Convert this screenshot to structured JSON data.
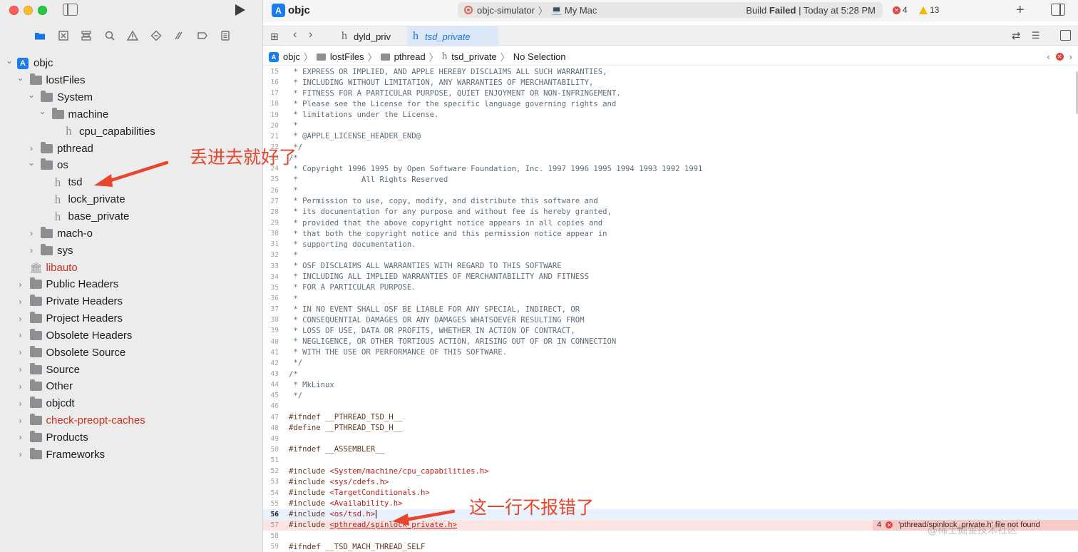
{
  "window": {
    "project_title": "objc",
    "scheme_target": "objc-simulator",
    "scheme_device": "My Mac",
    "build_status_prefix": "Build ",
    "build_status_result": "Failed",
    "build_status_time": " | Today at 5:28 PM",
    "error_count": "4",
    "warning_count": "13"
  },
  "sidebar": {
    "tree": [
      {
        "label": "objc",
        "depth": 0,
        "type": "app",
        "expanded": true
      },
      {
        "label": "lostFiles",
        "depth": 1,
        "type": "folder",
        "expanded": true
      },
      {
        "label": "System",
        "depth": 2,
        "type": "folder",
        "expanded": true
      },
      {
        "label": "machine",
        "depth": 3,
        "type": "folder",
        "expanded": true
      },
      {
        "label": "cpu_capabilities",
        "depth": 4,
        "type": "header"
      },
      {
        "label": "pthread",
        "depth": 2,
        "type": "folder",
        "expanded": false
      },
      {
        "label": "os",
        "depth": 2,
        "type": "folder",
        "expanded": true
      },
      {
        "label": "tsd",
        "depth": 3,
        "type": "header"
      },
      {
        "label": "lock_private",
        "depth": 3,
        "type": "header"
      },
      {
        "label": "base_private",
        "depth": 3,
        "type": "header"
      },
      {
        "label": "mach-o",
        "depth": 2,
        "type": "folder",
        "expanded": false
      },
      {
        "label": "sys",
        "depth": 2,
        "type": "folder",
        "expanded": false
      },
      {
        "label": "libauto",
        "depth": 1,
        "type": "library",
        "red": true
      },
      {
        "label": "Public Headers",
        "depth": 1,
        "type": "folder",
        "expanded": false
      },
      {
        "label": "Private Headers",
        "depth": 1,
        "type": "folder",
        "expanded": false
      },
      {
        "label": "Project Headers",
        "depth": 1,
        "type": "folder",
        "expanded": false
      },
      {
        "label": "Obsolete Headers",
        "depth": 1,
        "type": "folder",
        "expanded": false
      },
      {
        "label": "Obsolete Source",
        "depth": 1,
        "type": "folder",
        "expanded": false
      },
      {
        "label": "Source",
        "depth": 1,
        "type": "folder",
        "expanded": false
      },
      {
        "label": "Other",
        "depth": 1,
        "type": "folder",
        "expanded": false
      },
      {
        "label": "objcdt",
        "depth": 1,
        "type": "folder",
        "expanded": false
      },
      {
        "label": "check-preopt-caches",
        "depth": 1,
        "type": "folder",
        "expanded": false,
        "red": true
      },
      {
        "label": "Products",
        "depth": 1,
        "type": "folder",
        "expanded": false
      },
      {
        "label": "Frameworks",
        "depth": 1,
        "type": "folder",
        "expanded": false
      }
    ]
  },
  "tabs": [
    {
      "label": "dyld_priv",
      "active": false
    },
    {
      "label": "tsd_private",
      "active": true
    }
  ],
  "jumpbar": {
    "items": [
      "objc",
      "lostFiles",
      "pthread",
      "tsd_private"
    ],
    "selection": "No Selection"
  },
  "code": {
    "current_line": 56,
    "error_line": 57,
    "lines": [
      {
        "n": "15",
        "text": " * EXPRESS OR IMPLIED, AND APPLE HEREBY DISCLAIMS ALL SUCH WARRANTIES,"
      },
      {
        "n": "16",
        "text": " * INCLUDING WITHOUT LIMITATION, ANY WARRANTIES OF MERCHANTABILITY,"
      },
      {
        "n": "17",
        "text": " * FITNESS FOR A PARTICULAR PURPOSE, QUIET ENJOYMENT OR NON-INFRINGEMENT."
      },
      {
        "n": "18",
        "text": " * Please see the License for the specific language governing rights and"
      },
      {
        "n": "19",
        "text": " * limitations under the License."
      },
      {
        "n": "20",
        "text": " *"
      },
      {
        "n": "21",
        "text": " * @APPLE_LICENSE_HEADER_END@"
      },
      {
        "n": "22",
        "text": " */"
      },
      {
        "n": "23",
        "text": "/*"
      },
      {
        "n": "24",
        "text": " * Copyright 1996 1995 by Open Software Foundation, Inc. 1997 1996 1995 1994 1993 1992 1991"
      },
      {
        "n": "25",
        "text": " *              All Rights Reserved"
      },
      {
        "n": "26",
        "text": " *"
      },
      {
        "n": "27",
        "text": " * Permission to use, copy, modify, and distribute this software and"
      },
      {
        "n": "28",
        "text": " * its documentation for any purpose and without fee is hereby granted,"
      },
      {
        "n": "29",
        "text": " * provided that the above copyright notice appears in all copies and"
      },
      {
        "n": "30",
        "text": " * that both the copyright notice and this permission notice appear in"
      },
      {
        "n": "31",
        "text": " * supporting documentation."
      },
      {
        "n": "32",
        "text": " *"
      },
      {
        "n": "33",
        "text": " * OSF DISCLAIMS ALL WARRANTIES WITH REGARD TO THIS SOFTWARE"
      },
      {
        "n": "34",
        "text": " * INCLUDING ALL IMPLIED WARRANTIES OF MERCHANTABILITY AND FITNESS"
      },
      {
        "n": "35",
        "text": " * FOR A PARTICULAR PURPOSE."
      },
      {
        "n": "36",
        "text": " *"
      },
      {
        "n": "37",
        "text": " * IN NO EVENT SHALL OSF BE LIABLE FOR ANY SPECIAL, INDIRECT, OR"
      },
      {
        "n": "38",
        "text": " * CONSEQUENTIAL DAMAGES OR ANY DAMAGES WHATSOEVER RESULTING FROM"
      },
      {
        "n": "39",
        "text": " * LOSS OF USE, DATA OR PROFITS, WHETHER IN ACTION OF CONTRACT,"
      },
      {
        "n": "40",
        "text": " * NEGLIGENCE, OR OTHER TORTIOUS ACTION, ARISING OUT OF OR IN CONNECTION"
      },
      {
        "n": "41",
        "text": " * WITH THE USE OR PERFORMANCE OF THIS SOFTWARE."
      },
      {
        "n": "42",
        "text": " */"
      },
      {
        "n": "43",
        "text": "/*"
      },
      {
        "n": "44",
        "text": " * MkLinux"
      },
      {
        "n": "45",
        "text": " */"
      },
      {
        "n": "46",
        "text": ""
      },
      {
        "n": "47",
        "text": "#ifndef __PTHREAD_TSD_H__",
        "pp": true
      },
      {
        "n": "48",
        "text": "#define __PTHREAD_TSD_H__",
        "pp": true
      },
      {
        "n": "49",
        "text": ""
      },
      {
        "n": "50",
        "text": "#ifndef __ASSEMBLER__",
        "pp": true
      },
      {
        "n": "51",
        "text": ""
      },
      {
        "n": "52",
        "text": "#include ",
        "inc": "<System/machine/cpu_capabilities.h>"
      },
      {
        "n": "53",
        "text": "#include ",
        "inc": "<sys/cdefs.h>"
      },
      {
        "n": "54",
        "text": "#include ",
        "inc": "<TargetConditionals.h>"
      },
      {
        "n": "55",
        "text": "#include ",
        "inc": "<Availability.h>"
      },
      {
        "n": "56",
        "text": "#include ",
        "inc": "<os/tsd.h>"
      },
      {
        "n": "57",
        "text": "#include ",
        "inc": "<pthread/spinlock_private.h>"
      },
      {
        "n": "58",
        "text": ""
      },
      {
        "n": "59",
        "text": "#ifndef __TSD_MACH_THREAD_SELF",
        "pp": true
      }
    ]
  },
  "error_message": {
    "count": "4",
    "text": "'pthread/spinlock_private.h' file not found"
  },
  "annotations": {
    "note1": "丢进去就好了",
    "note2": "这一行不报错了",
    "color": "#e8452c"
  },
  "watermark": "@稀土掘金技术社区",
  "colors": {
    "accent": "#1a73e8",
    "error": "#e0443e",
    "warning": "#f4b400"
  }
}
